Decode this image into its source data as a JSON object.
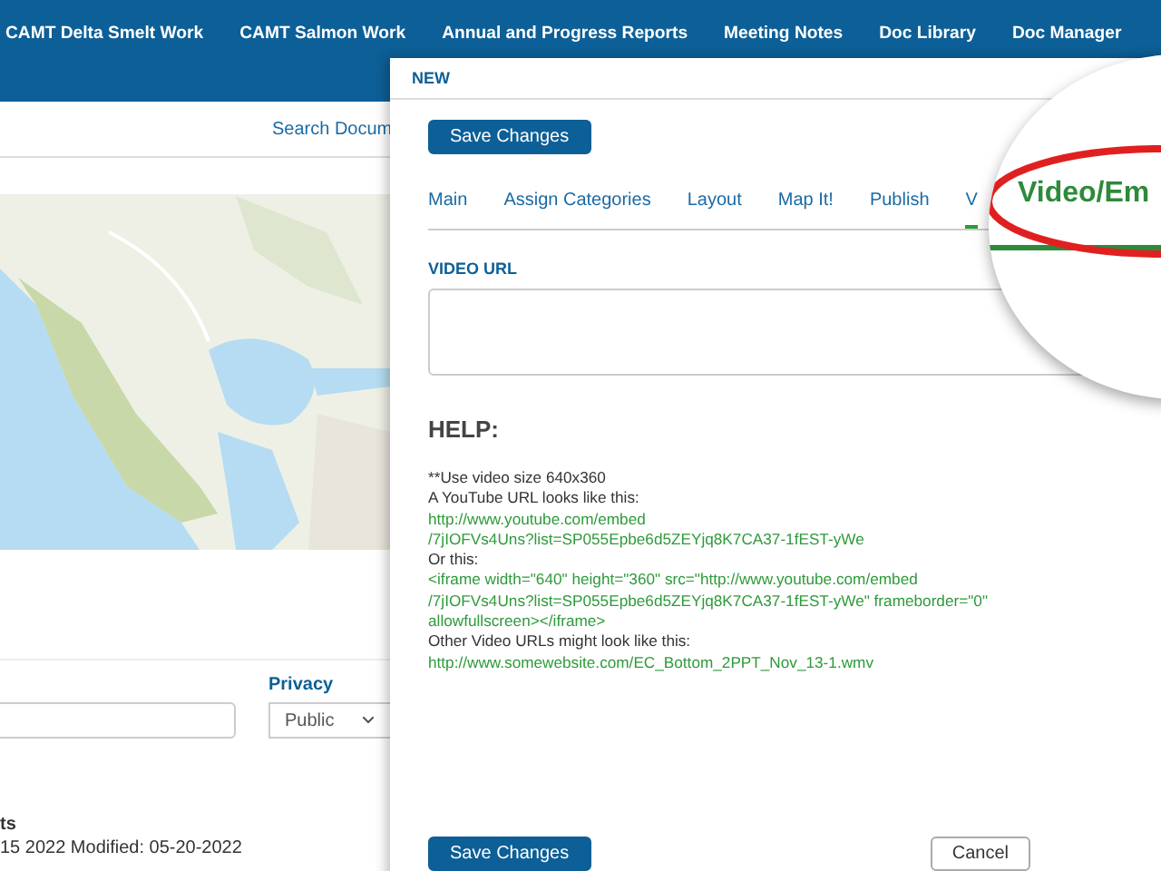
{
  "nav": {
    "items": [
      "CAMT Delta Smelt Work",
      "CAMT Salmon Work",
      "Annual and Progress Reports",
      "Meeting Notes",
      "Doc Library",
      "Doc Manager"
    ]
  },
  "background_page": {
    "search_link": "Search Docum",
    "privacy_label": "Privacy",
    "privacy_value": "Public",
    "footer_line_1": "ts",
    "footer_line_2": "15 2022 Modified: 05-20-2022"
  },
  "modal": {
    "title": "NEW",
    "save_button": "Save Changes",
    "tabs": [
      {
        "label": "Main",
        "selected": false
      },
      {
        "label": "Assign Categories",
        "selected": false
      },
      {
        "label": "Layout",
        "selected": false
      },
      {
        "label": "Map It!",
        "selected": false
      },
      {
        "label": "Publish",
        "selected": false
      },
      {
        "label": "V",
        "selected": true
      }
    ],
    "magnifier": {
      "text": "Video/Em"
    },
    "video_url_label": "VIDEO URL",
    "help_title": "HELP:",
    "help_lines": [
      {
        "text": "**Use video size 640x360",
        "kind": "note"
      },
      {
        "text": "A YouTube URL looks like this:",
        "kind": "note"
      },
      {
        "text": "http://www.youtube.com/embed",
        "kind": "example"
      },
      {
        "text": "/7jIOFVs4Uns?list=SP055Epbe6d5ZEYjq8K7CA37-1fEST-yWe",
        "kind": "example"
      },
      {
        "text": "Or this:",
        "kind": "note"
      },
      {
        "text": "<iframe width=\"640\" height=\"360\" src=\"http://www.youtube.com/embed",
        "kind": "example"
      },
      {
        "text": "/7jIOFVs4Uns?list=SP055Epbe6d5ZEYjq8K7CA37-1fEST-yWe\" frameborder=\"0\"",
        "kind": "example"
      },
      {
        "text": "allowfullscreen></iframe>",
        "kind": "example"
      },
      {
        "text": "Other Video URLs might look like this:",
        "kind": "note"
      },
      {
        "text": "http://www.somewebsite.com/EC_Bottom_2PPT_Nov_13-1.wmv",
        "kind": "example"
      }
    ],
    "footer_buttons": [
      {
        "label": "Save Changes",
        "kind": "primary"
      },
      {
        "label": "Cancel",
        "kind": "secondary"
      }
    ]
  }
}
